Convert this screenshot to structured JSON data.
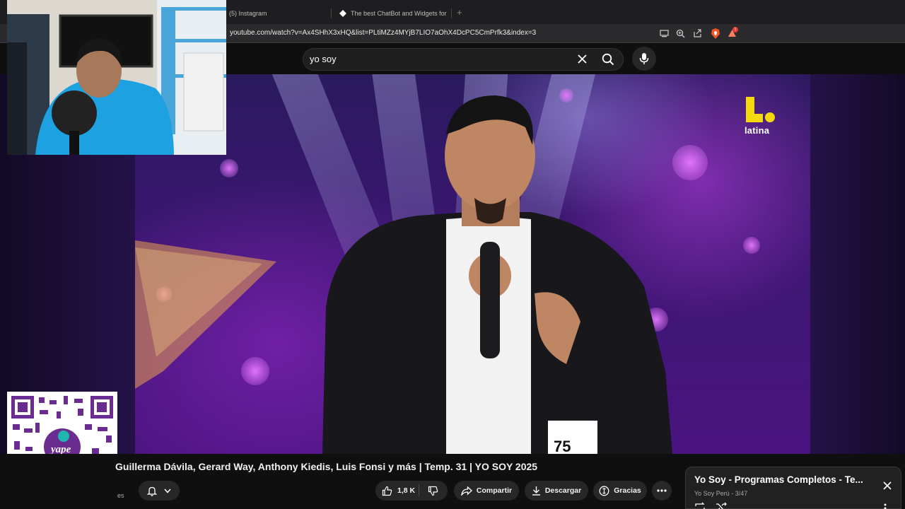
{
  "browser": {
    "tabs": [
      {
        "label": "(5) Instagram"
      },
      {
        "label": "The best ChatBot and Widgets for Ki"
      }
    ],
    "url": "youtube.com/watch?v=Ax4SHhX3xHQ&list=PLtiMZz4MYjB7LIO7aOhX4DcPC5CmPrfk3&index=3",
    "notification_badge": "1"
  },
  "search": {
    "query": "yo soy"
  },
  "video": {
    "channel_logo_text": "latina",
    "title": "Guillerma Dávila, Gerard Way, Anthony Kiedis, Luis Fonsi y más | Temp. 31 | YO SOY 2025",
    "channel_fragment": "es",
    "likes": "1,8 K",
    "share_label": "Compartir",
    "download_label": "Descargar",
    "thanks_label": "Gracias"
  },
  "playlist": {
    "title": "Yo Soy - Programas Completos - Te...",
    "channel": "Yo Soy Perú",
    "position": "3/47"
  },
  "colors": {
    "background": "#0f0f0f",
    "pill": "#272727",
    "accent_logo": "#f5d90a"
  }
}
